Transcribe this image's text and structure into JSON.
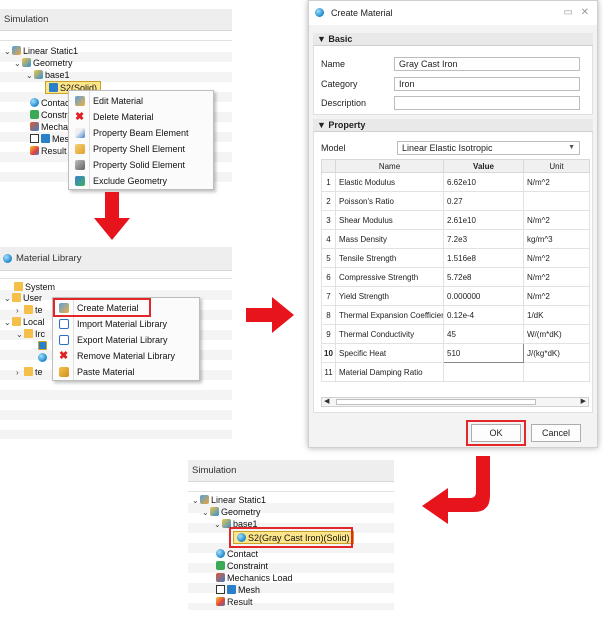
{
  "sim_panel": {
    "title": "Simulation",
    "tree": {
      "linear_static": "Linear Static1",
      "geometry": "Geometry",
      "base": "base1",
      "solid": "S2(Solid)",
      "contact": "Contact",
      "constraint": "Constrai",
      "mechanics": "Mechan",
      "mesh": "Mes",
      "result": "Result"
    }
  },
  "context_menu_1": {
    "items": [
      {
        "label": "Edit Material",
        "icon": "material-icon"
      },
      {
        "label": "Delete Material",
        "icon": "delete-x-icon"
      },
      {
        "label": "Property Beam Element",
        "icon": "beam-icon"
      },
      {
        "label": "Property Shell Element",
        "icon": "shell-icon"
      },
      {
        "label": "Property Solid Element",
        "icon": "solid-icon"
      },
      {
        "label": "Exclude Geometry",
        "icon": "exclude-icon"
      }
    ]
  },
  "library_panel": {
    "title": "Material Library",
    "tree": {
      "system": "System",
      "user": "User",
      "te": "te",
      "local": "Local",
      "iron": "Irc",
      "te2": "te"
    }
  },
  "context_menu_2": {
    "items": [
      {
        "label": "Create Material",
        "icon": "material-icon"
      },
      {
        "label": "Import Material Library",
        "icon": "import-icon"
      },
      {
        "label": "Export Material Library",
        "icon": "export-icon"
      },
      {
        "label": "Remove Material Library",
        "icon": "delete-x-icon"
      },
      {
        "label": "Paste Material",
        "icon": "paste-icon"
      }
    ]
  },
  "dialog": {
    "title": "Create Material",
    "basic_header": "▼ Basic",
    "name_label": "Name",
    "name_value": "Gray Cast Iron",
    "category_label": "Category",
    "category_value": "Iron",
    "description_label": "Description",
    "description_value": "",
    "property_header": "▼ Property",
    "model_label": "Model",
    "model_value": "Linear Elastic Isotropic",
    "columns": {
      "name": "Name",
      "value": "Value",
      "unit": "Unit"
    },
    "rows": [
      {
        "n": "1",
        "name": "Elastic Modulus",
        "value": "6.62e10",
        "unit": "N/m^2"
      },
      {
        "n": "2",
        "name": "Poisson's Ratio",
        "value": "0.27",
        "unit": ""
      },
      {
        "n": "3",
        "name": "Shear Modulus",
        "value": "2.61e10",
        "unit": "N/m^2"
      },
      {
        "n": "4",
        "name": "Mass Density",
        "value": "7.2e3",
        "unit": "kg/m^3"
      },
      {
        "n": "5",
        "name": "Tensile Strength",
        "value": "1.516e8",
        "unit": "N/m^2"
      },
      {
        "n": "6",
        "name": "Compressive Strength",
        "value": "5.72e8",
        "unit": "N/m^2"
      },
      {
        "n": "7",
        "name": "Yield Strength",
        "value": "0.000000",
        "unit": "N/m^2"
      },
      {
        "n": "8",
        "name": "Thermal Expansion Coefficient",
        "value": "0.12e-4",
        "unit": "1/dK"
      },
      {
        "n": "9",
        "name": "Thermal Conductivity",
        "value": "45",
        "unit": "W/(m*dK)"
      },
      {
        "n": "10",
        "name": "Specific Heat",
        "value": "510",
        "unit": "J/(kg*dK)"
      },
      {
        "n": "11",
        "name": "Material Damping Ratio",
        "value": "",
        "unit": ""
      }
    ],
    "ok_label": "OK",
    "cancel_label": "Cancel"
  },
  "result_panel": {
    "title": "Simulation",
    "tree": {
      "linear_static": "Linear Static1",
      "geometry": "Geometry",
      "base": "base1",
      "solid": "S2(Gray Cast Iron)(Solid)",
      "contact": "Contact",
      "constraint": "Constraint",
      "mechanics": "Mechanics Load",
      "mesh": "Mesh",
      "result": "Result"
    }
  },
  "colors": {
    "highlight": "#e3262a",
    "arrow": "#e8141c",
    "selection": "#fde68a"
  }
}
